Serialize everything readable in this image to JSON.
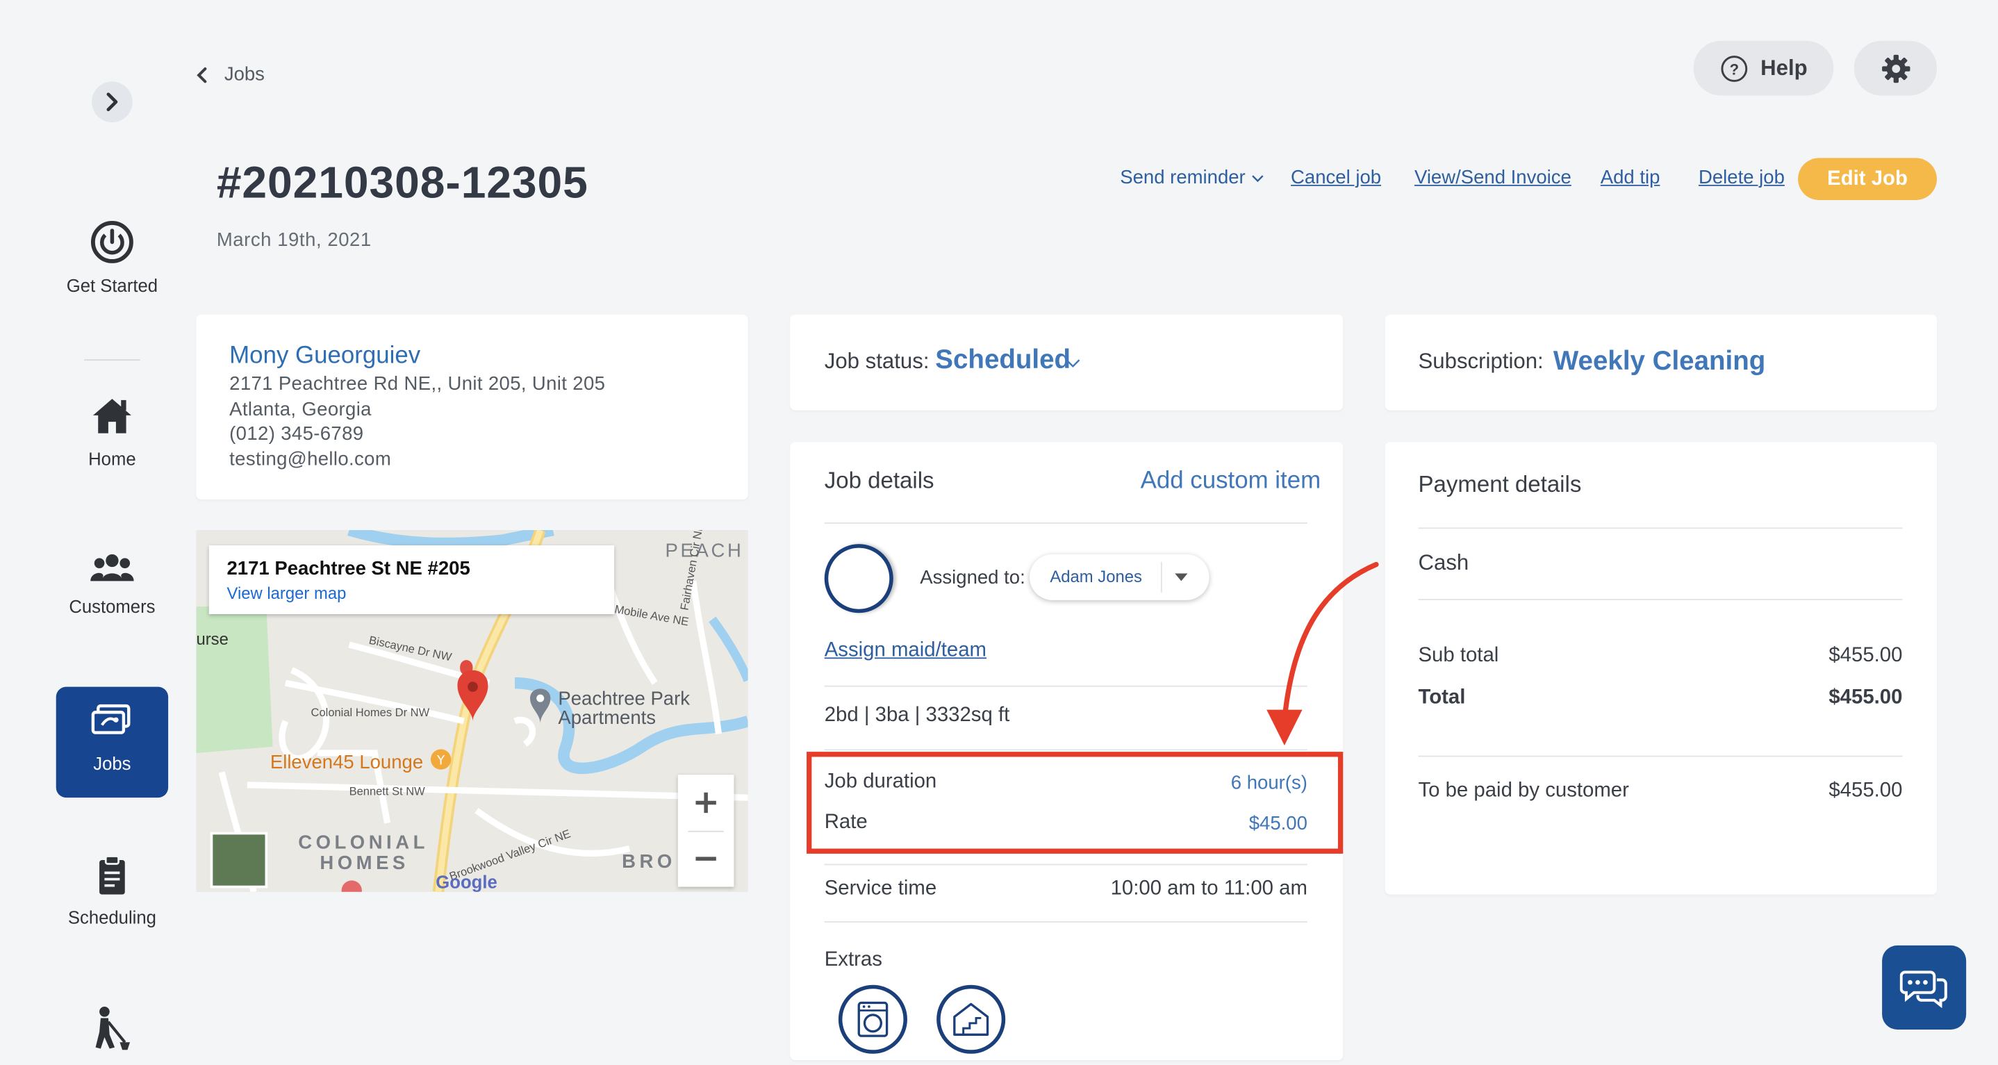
{
  "sidebar": {
    "items": [
      {
        "label": "Get Started",
        "icon": "power-icon"
      },
      {
        "label": "Home",
        "icon": "home-icon"
      },
      {
        "label": "Customers",
        "icon": "users-icon"
      },
      {
        "label": "Jobs",
        "icon": "jobs-icon",
        "active": true
      },
      {
        "label": "Scheduling",
        "icon": "clipboard-icon"
      },
      {
        "label": "",
        "icon": "cleaner-icon"
      }
    ]
  },
  "header": {
    "breadcrumb": "Jobs",
    "title": "#20210308-12305",
    "date": "March 19th, 2021",
    "help_label": "Help"
  },
  "actions": {
    "send_reminder": "Send reminder",
    "cancel_job": "Cancel job",
    "view_invoice": "View/Send Invoice",
    "add_tip": "Add tip",
    "delete_job": "Delete job",
    "edit_job": "Edit Job"
  },
  "customer": {
    "name": "Mony Gueorguiev",
    "address": "2171 Peachtree Rd NE,, Unit 205, Unit 205",
    "city": "Atlanta, Georgia",
    "phone": "(012) 345-6789",
    "email": "testing@hello.com"
  },
  "map": {
    "place_title": "2171 Peachtree St NE #205",
    "link": "View larger map",
    "labels": {
      "peachtree_park": "Peachtree Park",
      "apartments": "Apartments",
      "lounge": "Elleven45 Lounge",
      "colonial": "COLONIAL",
      "homes": "HOMES",
      "peach": "PEACH",
      "brook": "BRO",
      "google": "Google",
      "urse": "urse",
      "biscayne": "Biscayne Dr NW",
      "colonial_homes_dr": "Colonial Homes Dr NW",
      "bennett": "Bennett St NW",
      "mobile": "Mobile Ave NE",
      "brookwood": "Brookwood Valley Cir NE",
      "fairhaven": "Fairhaven Cir NE"
    }
  },
  "job_status": {
    "label": "Job status:",
    "value": "Scheduled"
  },
  "subscription": {
    "label": "Subscription:",
    "value": "Weekly Cleaning"
  },
  "job_details": {
    "title": "Job details",
    "add_custom": "Add custom item",
    "assigned_label": "Assigned to:",
    "assignee": "Adam Jones",
    "assign_link": "Assign maid/team",
    "rooms": "2bd | 3ba | 3332sq ft",
    "duration_label": "Job duration",
    "duration_value": "6 hour(s)",
    "rate_label": "Rate",
    "rate_value": "$45.00",
    "service_label": "Service time",
    "service_value": "10:00 am to 11:00 am",
    "extras_label": "Extras"
  },
  "payment": {
    "title": "Payment details",
    "method": "Cash",
    "subtotal_label": "Sub total",
    "subtotal_value": "$455.00",
    "total_label": "Total",
    "total_value": "$455.00",
    "tobepaid_label": "To be paid by customer",
    "tobepaid_value": "$455.00"
  },
  "colors": {
    "accent": "#2d6db3",
    "nav_active": "#17458f",
    "edit_button": "#f5b94a",
    "highlight": "#e53d29"
  }
}
